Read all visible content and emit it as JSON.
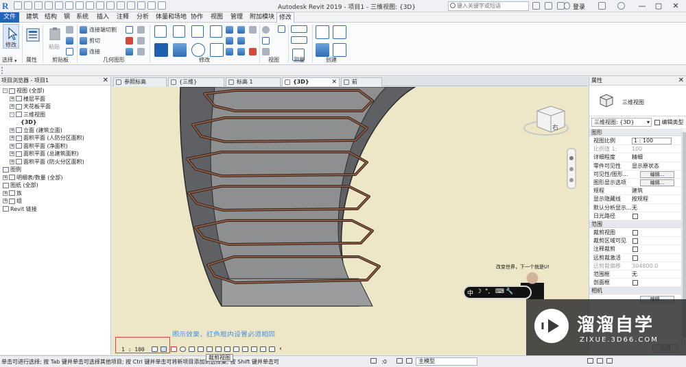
{
  "titlebar": {
    "title": "Autodesk Revit 2019 -  项目1 - 三维视图: {3D}",
    "search_placeholder": "键入关键字或短语",
    "login": "登录"
  },
  "menu": [
    "文件",
    "建筑",
    "结构",
    "钢",
    "系统",
    "插入",
    "注释",
    "分析",
    "体量和场地",
    "协作",
    "视图",
    "管理",
    "附加模块",
    "修改"
  ],
  "ribbon": {
    "modify_label": "修改",
    "select_label": "选择",
    "properties_label": "属性",
    "clipboard_label": "剪贴板",
    "paste_label": "粘贴",
    "geometry_label": "几何图形",
    "cut_join_label": "连接端切割",
    "cut_label": "剪切",
    "join_label": "连接",
    "modify_group_label": "修改",
    "view_label": "视图",
    "measure_label": "测量",
    "create_label": "创建"
  },
  "browser": {
    "title": "项目浏览器 - 项目1",
    "items": [
      {
        "label": "视图 (全部)",
        "toggle": "-"
      },
      {
        "label": "楼层平面",
        "toggle": "+"
      },
      {
        "label": "天花板平面",
        "toggle": "+"
      },
      {
        "label": "三维视图",
        "toggle": "-"
      },
      {
        "label": "{3D}",
        "toggle": ""
      },
      {
        "label": "立面 (建筑立面)",
        "toggle": "+"
      },
      {
        "label": "面积平面 (人防分区面积)",
        "toggle": "+"
      },
      {
        "label": "面积平面 (净面积)",
        "toggle": "+"
      },
      {
        "label": "面积平面 (总建筑面积)",
        "toggle": "+"
      },
      {
        "label": "面积平面 (防火分区面积)",
        "toggle": "+"
      },
      {
        "label": "图例",
        "toggle": ""
      },
      {
        "label": "明细表/数量 (全部)",
        "toggle": "+"
      },
      {
        "label": "图纸 (全部)",
        "toggle": ""
      },
      {
        "label": "族",
        "toggle": "+"
      },
      {
        "label": "组",
        "toggle": "+"
      },
      {
        "label": "Revit 链接",
        "toggle": ""
      }
    ]
  },
  "tabs": [
    {
      "label": "参照标高"
    },
    {
      "label": "{三维}"
    },
    {
      "label": "标高 1"
    },
    {
      "label": "{3D}"
    },
    {
      "label": "前"
    }
  ],
  "canvas": {
    "caption": "图示效果，红色框内设置必须相同",
    "viewcube_face": "右",
    "camera_text": "改变世界，下一个就是U!",
    "popup_chars": [
      "中",
      "☽",
      "°,",
      "⌨",
      "🔧"
    ]
  },
  "viewbar": {
    "scale": "1 : 100",
    "tooltip": "裁剪视图"
  },
  "properties": {
    "title": "属性",
    "type_name": "三维视图",
    "type_select": "三维视图: {3D}",
    "edit_type": "编辑类型",
    "categories": [
      "图形",
      "范围",
      "相机"
    ],
    "graphics_rows": [
      {
        "name": "视图比例",
        "value": "1 : 100",
        "kind": "input"
      },
      {
        "name": "比例值 1:",
        "value": "100",
        "kind": "grey"
      },
      {
        "name": "详细程度",
        "value": "精细",
        "kind": "text"
      },
      {
        "name": "零件可见性",
        "value": "显示原状态",
        "kind": "text"
      },
      {
        "name": "可见性/图形...",
        "value": "编辑...",
        "kind": "button"
      },
      {
        "name": "图形显示选项",
        "value": "编辑...",
        "kind": "button"
      },
      {
        "name": "规程",
        "value": "建筑",
        "kind": "text"
      },
      {
        "name": "显示隐藏线",
        "value": "按规程",
        "kind": "text"
      },
      {
        "name": "默认分析显示...",
        "value": "无",
        "kind": "text"
      },
      {
        "name": "日光路径",
        "value": "",
        "kind": "check"
      }
    ],
    "extents_rows": [
      {
        "name": "裁剪视图",
        "value": "",
        "kind": "check"
      },
      {
        "name": "裁剪区域可见",
        "value": "",
        "kind": "check"
      },
      {
        "name": "注释裁剪",
        "value": "",
        "kind": "check"
      },
      {
        "name": "远剪裁激活",
        "value": "",
        "kind": "check"
      },
      {
        "name": "远剪裁偏移",
        "value": "304800.0",
        "kind": "grey"
      },
      {
        "name": "范围框",
        "value": "无",
        "kind": "text"
      },
      {
        "name": "剖面框",
        "value": "",
        "kind": "check"
      }
    ],
    "camera_button": "编辑...",
    "apply": "应用"
  },
  "statusbar": {
    "text": "单击可进行选择; 按 Tab 键并单击可选择其他项目; 按 Ctrl 键并单击可将新项目添加到选择集; 按 Shift 键并单击可",
    "zero1": ":0",
    "model": "主模型"
  },
  "watermark": {
    "title": "溜溜自学",
    "url": "ZIXUE.3D66.COM"
  }
}
